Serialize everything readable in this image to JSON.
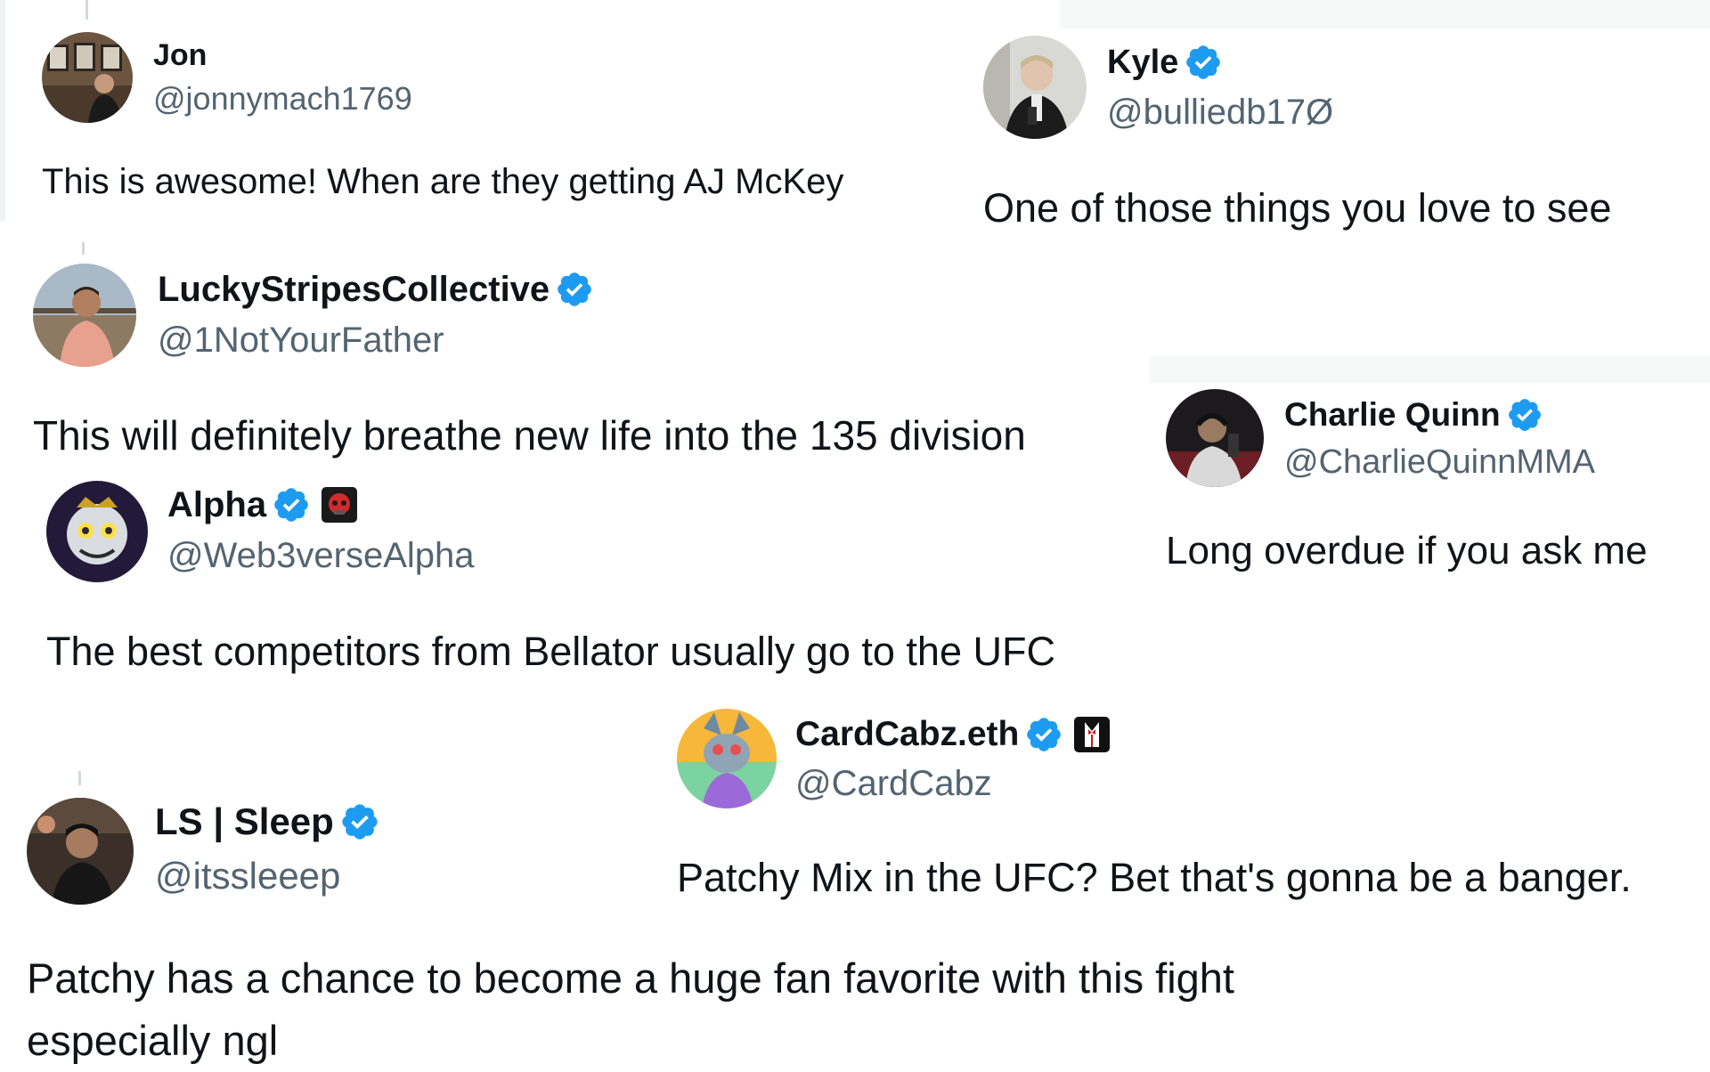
{
  "colors": {
    "verified": "#1d9bf0",
    "name": "#0f1419",
    "handle": "#536471",
    "thread_line": "#cfd9de"
  },
  "tweets": [
    {
      "id": "jon",
      "name": "Jon",
      "handle": "@jonnymach1769",
      "verified": false,
      "text": "This is awesome!  When are they getting AJ McKey"
    },
    {
      "id": "kyle",
      "name": "Kyle",
      "handle": "@bulliedb17Ø",
      "verified": true,
      "text": "One of those things you love to see"
    },
    {
      "id": "lucky",
      "name": "LuckyStripesCollective",
      "handle": "@1NotYourFather",
      "verified": true,
      "text": "This will definitely breathe new life into the 135 division"
    },
    {
      "id": "charlie",
      "name": "Charlie Quinn",
      "handle": "@CharlieQuinnMMA",
      "verified": true,
      "text": "Long overdue if you ask me"
    },
    {
      "id": "alpha",
      "name": "Alpha",
      "handle": "@Web3verseAlpha",
      "verified": true,
      "affiliate_icon": "red-mask-affiliate-icon",
      "text": "The best competitors from Bellator usually go to the UFC"
    },
    {
      "id": "cardcabz",
      "name": "CardCabz.eth",
      "handle": "@CardCabz",
      "verified": true,
      "affiliate_icon": "tuxedo-affiliate-icon",
      "text": "Patchy Mix in the UFC? Bet that's gonna be a banger."
    },
    {
      "id": "sleep",
      "name": "LS | Sleep",
      "handle": "@itssleeep",
      "verified": true,
      "text": "Patchy has a chance to become a huge fan favorite with this fight especially ngl"
    }
  ]
}
